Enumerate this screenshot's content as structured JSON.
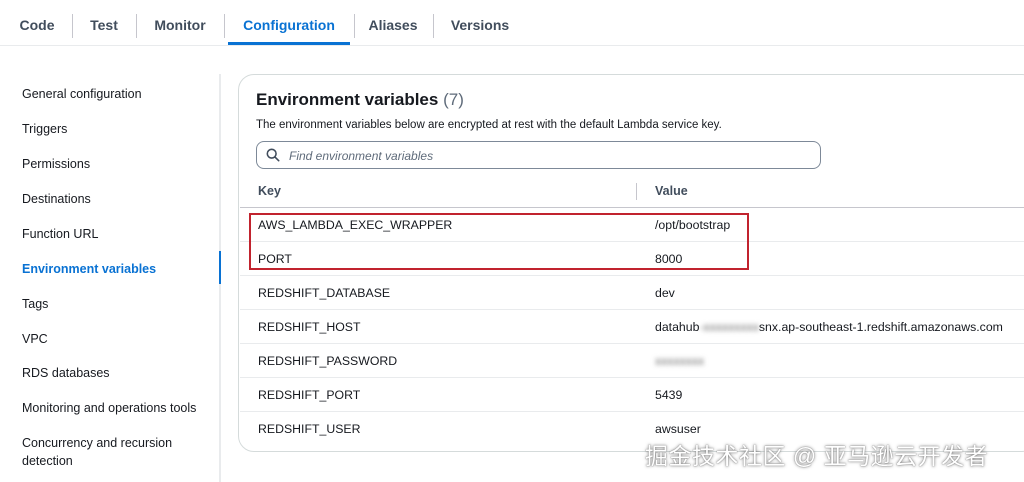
{
  "tabs": [
    {
      "label": "Code"
    },
    {
      "label": "Test"
    },
    {
      "label": "Monitor"
    },
    {
      "label": "Configuration"
    },
    {
      "label": "Aliases"
    },
    {
      "label": "Versions"
    }
  ],
  "active_tab": "Configuration",
  "sidebar": {
    "items": [
      {
        "label": "General configuration"
      },
      {
        "label": "Triggers"
      },
      {
        "label": "Permissions"
      },
      {
        "label": "Destinations"
      },
      {
        "label": "Function URL"
      },
      {
        "label": "Environment variables"
      },
      {
        "label": "Tags"
      },
      {
        "label": "VPC"
      },
      {
        "label": "RDS databases"
      },
      {
        "label": "Monitoring and operations tools"
      },
      {
        "label": "Concurrency and recursion detection"
      }
    ],
    "active": "Environment variables"
  },
  "panel": {
    "title": "Environment variables",
    "count": "(7)",
    "description": "The environment variables below are encrypted at rest with the default Lambda service key.",
    "search_placeholder": "Find environment variables"
  },
  "table": {
    "columns": [
      "Key",
      "Value"
    ],
    "rows": [
      {
        "key": "AWS_LAMBDA_EXEC_WRAPPER",
        "value": "/opt/bootstrap"
      },
      {
        "key": "PORT",
        "value": "8000"
      },
      {
        "key": "REDSHIFT_DATABASE",
        "value": "dev"
      },
      {
        "key": "REDSHIFT_HOST",
        "value_pre": "datahub",
        "value_blur": "-xxxxxxxxx",
        "value_post": "snx.ap-southeast-1.redshift.amazonaws.com"
      },
      {
        "key": "REDSHIFT_PASSWORD",
        "value_blur": "xxxxxxxx"
      },
      {
        "key": "REDSHIFT_PORT",
        "value": "5439"
      },
      {
        "key": "REDSHIFT_USER",
        "value": "awsuser"
      }
    ]
  },
  "watermark": "掘金技术社区 @ 亚马逊云开发者",
  "colors": {
    "accent": "#0972d3",
    "highlight_border": "#c1232e",
    "text": "#16191f",
    "muted": "#5f6b7a"
  },
  "icons": {
    "search": "search-icon"
  }
}
